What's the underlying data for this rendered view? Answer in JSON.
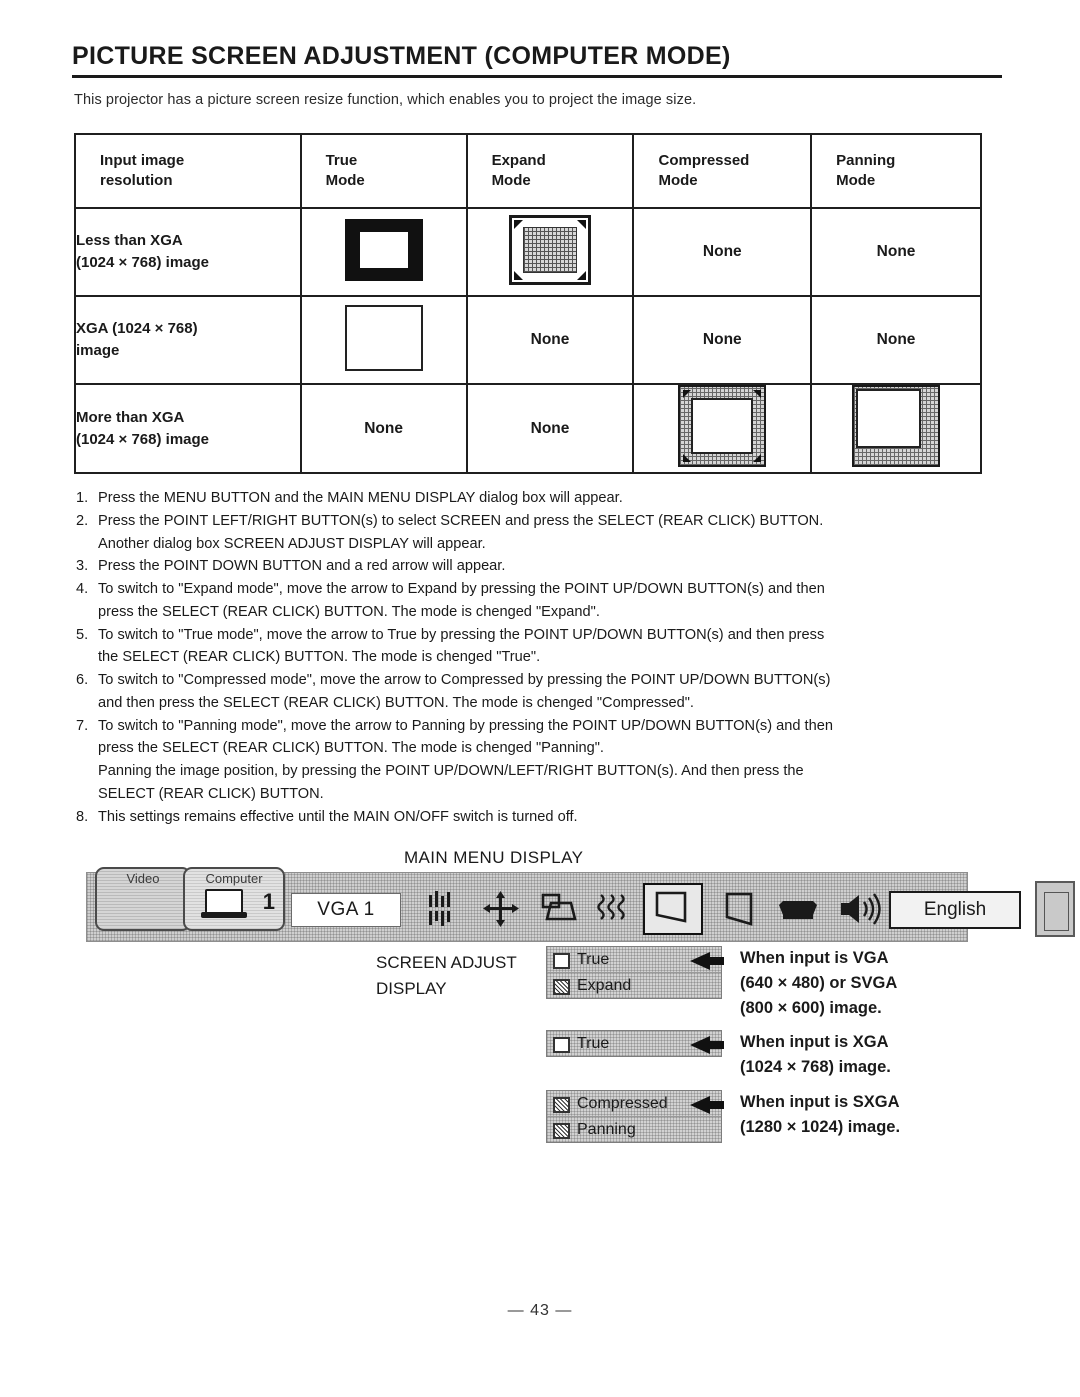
{
  "document": {
    "title": "PICTURE SCREEN ADJUSTMENT (COMPUTER MODE)",
    "intro": "This projector has a picture screen resize function, which enables you to project the image size.",
    "page_number": "— 43 —"
  },
  "table": {
    "headers": [
      "Input image\nresolution",
      "True\nMode",
      "Expand\nMode",
      "Compressed\nMode",
      "Panning\nMode"
    ],
    "header_cells": {
      "c0_line1": "Input image",
      "c0_line2": "resolution",
      "c1_line1": "True",
      "c1_line2": "Mode",
      "c2_line1": "Expand",
      "c2_line2": "Mode",
      "c3_line1": "Compressed",
      "c3_line2": "Mode",
      "c4_line1": "Panning",
      "c4_line2": "Mode"
    },
    "rows": [
      {
        "label_line1": "Less than XGA",
        "label_line2": "(1024 × 768) image",
        "true_mode": "diagram-filled-frame",
        "expand_mode": "diagram-expand-arrows",
        "compressed_mode": "None",
        "panning_mode": "None"
      },
      {
        "label_line1": "XGA (1024 × 768)",
        "label_line2": "image",
        "true_mode": "diagram-plain-box",
        "expand_mode": "None",
        "compressed_mode": "None",
        "panning_mode": "None"
      },
      {
        "label_line1": "More than XGA",
        "label_line2": "(1024 × 768) image",
        "true_mode": "None",
        "expand_mode": "None",
        "compressed_mode": "diagram-compressed-arrows",
        "panning_mode": "diagram-panning-offset"
      }
    ]
  },
  "steps": [
    {
      "num": "1.",
      "text": "Press the MENU BUTTON and the MAIN MENU DISPLAY dialog box will appear.",
      "cont": ""
    },
    {
      "num": "2.",
      "text": "Press the POINT LEFT/RIGHT BUTTON(s) to select SCREEN and press the SELECT (REAR CLICK) BUTTON.",
      "cont": "Another dialog box SCREEN ADJUST DISPLAY will appear."
    },
    {
      "num": "3.",
      "text": "Press the POINT DOWN BUTTON and a red arrow will appear.",
      "cont": ""
    },
    {
      "num": "4.",
      "text": "To switch to \"Expand mode\", move the arrow to Expand by pressing the POINT UP/DOWN BUTTON(s) and then",
      "cont": "press the SELECT (REAR CLICK) BUTTON. The mode is chenged \"Expand\"."
    },
    {
      "num": "5.",
      "text": "To switch to \"True mode\", move the arrow to True by pressing the POINT UP/DOWN BUTTON(s) and then press",
      "cont": "the SELECT (REAR CLICK) BUTTON. The mode is chenged \"True\"."
    },
    {
      "num": "6.",
      "text": "To switch to \"Compressed mode\", move the arrow to Compressed by pressing the POINT UP/DOWN BUTTON(s)",
      "cont": "and then press the SELECT (REAR CLICK) BUTTON. The mode is chenged \"Compressed\"."
    },
    {
      "num": "7.",
      "text": "To switch to \"Panning mode\", move the arrow to Panning by pressing the POINT UP/DOWN BUTTON(s) and then",
      "cont": "press the SELECT (REAR CLICK) BUTTON. The mode is chenged \"Panning\".",
      "cont2": "Panning the image position, by pressing the POINT UP/DOWN/LEFT/RIGHT BUTTON(s). And then press the",
      "cont3": "SELECT (REAR CLICK) BUTTON."
    },
    {
      "num": "8.",
      "text": "This settings remains effective until the MAIN ON/OFF switch is turned off.",
      "cont": ""
    }
  ],
  "menu_mockup": {
    "caption": "MAIN MENU DISPLAY",
    "screen_label": "SCREEN",
    "tabs": [
      {
        "label": "Video",
        "active": false
      },
      {
        "label": "Computer",
        "active": true
      }
    ],
    "computer_number": "1",
    "input_value": "VGA 1",
    "language_value": "English",
    "icons": [
      "image-adjust-icon",
      "position-arrows-icon",
      "keystone-icon",
      "tracking-icon",
      "screen-icon",
      "screen-icon",
      "projector-icon",
      "volume-icon"
    ]
  },
  "screen_adjust": {
    "label_line1": "SCREEN ADJUST",
    "label_line2": "DISPLAY",
    "dialogs": [
      {
        "items": [
          {
            "label": "True",
            "marker": "box",
            "selected": true
          },
          {
            "label": "Expand",
            "marker": "hatch",
            "selected": false
          }
        ],
        "caption_lines": [
          "When input  is VGA",
          "(640 × 480) or SVGA",
          "(800 × 600) image."
        ]
      },
      {
        "items": [
          {
            "label": "True",
            "marker": "box",
            "selected": true
          }
        ],
        "caption_lines": [
          "When input  is XGA",
          "(1024 × 768) image."
        ]
      },
      {
        "items": [
          {
            "label": "Compressed",
            "marker": "hatch",
            "selected": true
          },
          {
            "label": "Panning",
            "marker": "hatch",
            "selected": false
          }
        ],
        "caption_lines": [
          "When input  is SXGA",
          "(1280 × 1024) image."
        ]
      }
    ]
  },
  "colors": {
    "ink": "#1a1a1a",
    "panel_gray": "#cfcfcf",
    "paper": "#ffffff"
  }
}
